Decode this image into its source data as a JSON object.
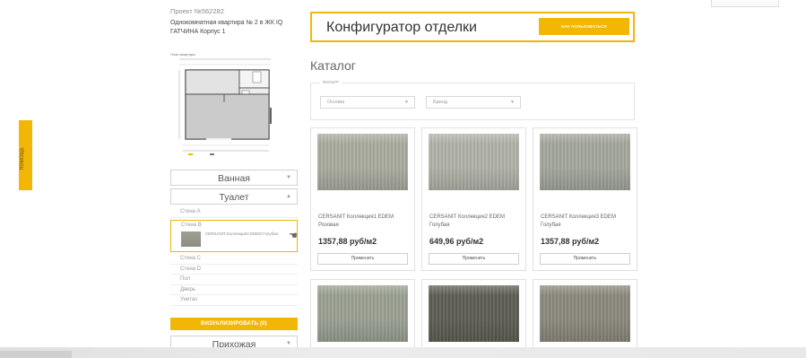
{
  "sidebar_tab": {
    "label": "ПОМОЩЬ"
  },
  "project": {
    "number": "Проект №562282",
    "description": "Однокомнатная квартира № 2 в ЖК IQ ГАТЧИНА Корпус 1"
  },
  "plan": {
    "label": "План квартиры"
  },
  "rooms": {
    "bath": "Ванная",
    "toilet": "Туалет",
    "hallway": "Прихожая"
  },
  "surfaces": {
    "wall_a": "Стена А",
    "wall_b": "Стена B",
    "wall_b_product": "CERSANIT Коллекция2 EDEM Голубая",
    "wall_c": "Стена С",
    "wall_d": "Стена D",
    "floor": "Пол",
    "door": "Дверь",
    "tiles": "Унитаз"
  },
  "visualize_label": "ВИЗУАЛИЗИРОВАТЬ (0)",
  "header": {
    "title": "Конфигуратор отделки",
    "howto_label": "КАК ПОЛЬЗОВАТЬСЯ"
  },
  "catalog": {
    "title": "Каталог",
    "filter_legend": "ФИЛЬТР",
    "filter_1": "Основа",
    "filter_2": "Бренд",
    "apply_label": "Применить",
    "cards": [
      {
        "name": "CERSANIT Коллекция1 EDEM Розовая",
        "price": "1357,88 руб/м2",
        "tone": "#a9ab9f"
      },
      {
        "name": "CERSANIT Коллекция2 EDEM Голубая",
        "price": "649,96 руб/м2",
        "tone": "#b0b2a7"
      },
      {
        "name": "CERSANIT Коллекция3 EDEM Голубая",
        "price": "1357,88 руб/м2",
        "tone": "#a3a69b"
      },
      {
        "tone": "#9aa092"
      },
      {
        "tone": "#5e5d52"
      },
      {
        "tone": "#8b897d"
      }
    ]
  },
  "colors": {
    "accent": "#f2b705",
    "border": "#e0e0e0",
    "text": "#333333"
  }
}
